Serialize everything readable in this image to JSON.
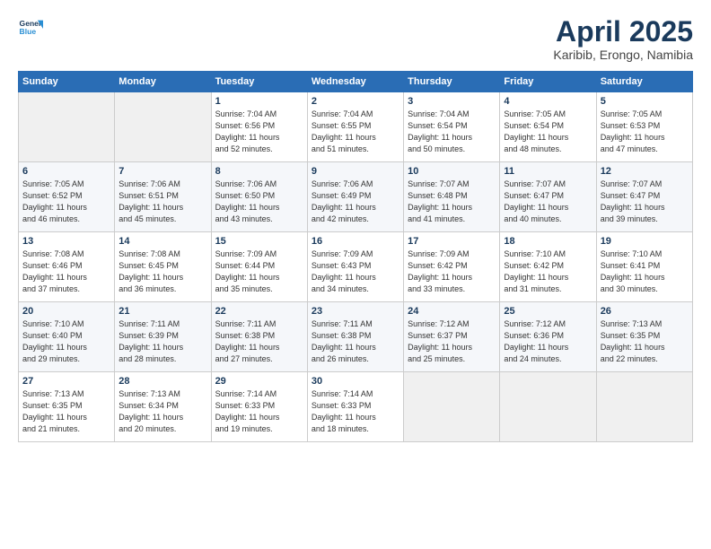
{
  "logo": {
    "line1": "General",
    "line2": "Blue"
  },
  "title": "April 2025",
  "location": "Karibib, Erongo, Namibia",
  "header_days": [
    "Sunday",
    "Monday",
    "Tuesday",
    "Wednesday",
    "Thursday",
    "Friday",
    "Saturday"
  ],
  "weeks": [
    [
      {
        "day": "",
        "info": ""
      },
      {
        "day": "",
        "info": ""
      },
      {
        "day": "1",
        "info": "Sunrise: 7:04 AM\nSunset: 6:56 PM\nDaylight: 11 hours\nand 52 minutes."
      },
      {
        "day": "2",
        "info": "Sunrise: 7:04 AM\nSunset: 6:55 PM\nDaylight: 11 hours\nand 51 minutes."
      },
      {
        "day": "3",
        "info": "Sunrise: 7:04 AM\nSunset: 6:54 PM\nDaylight: 11 hours\nand 50 minutes."
      },
      {
        "day": "4",
        "info": "Sunrise: 7:05 AM\nSunset: 6:54 PM\nDaylight: 11 hours\nand 48 minutes."
      },
      {
        "day": "5",
        "info": "Sunrise: 7:05 AM\nSunset: 6:53 PM\nDaylight: 11 hours\nand 47 minutes."
      }
    ],
    [
      {
        "day": "6",
        "info": "Sunrise: 7:05 AM\nSunset: 6:52 PM\nDaylight: 11 hours\nand 46 minutes."
      },
      {
        "day": "7",
        "info": "Sunrise: 7:06 AM\nSunset: 6:51 PM\nDaylight: 11 hours\nand 45 minutes."
      },
      {
        "day": "8",
        "info": "Sunrise: 7:06 AM\nSunset: 6:50 PM\nDaylight: 11 hours\nand 43 minutes."
      },
      {
        "day": "9",
        "info": "Sunrise: 7:06 AM\nSunset: 6:49 PM\nDaylight: 11 hours\nand 42 minutes."
      },
      {
        "day": "10",
        "info": "Sunrise: 7:07 AM\nSunset: 6:48 PM\nDaylight: 11 hours\nand 41 minutes."
      },
      {
        "day": "11",
        "info": "Sunrise: 7:07 AM\nSunset: 6:47 PM\nDaylight: 11 hours\nand 40 minutes."
      },
      {
        "day": "12",
        "info": "Sunrise: 7:07 AM\nSunset: 6:47 PM\nDaylight: 11 hours\nand 39 minutes."
      }
    ],
    [
      {
        "day": "13",
        "info": "Sunrise: 7:08 AM\nSunset: 6:46 PM\nDaylight: 11 hours\nand 37 minutes."
      },
      {
        "day": "14",
        "info": "Sunrise: 7:08 AM\nSunset: 6:45 PM\nDaylight: 11 hours\nand 36 minutes."
      },
      {
        "day": "15",
        "info": "Sunrise: 7:09 AM\nSunset: 6:44 PM\nDaylight: 11 hours\nand 35 minutes."
      },
      {
        "day": "16",
        "info": "Sunrise: 7:09 AM\nSunset: 6:43 PM\nDaylight: 11 hours\nand 34 minutes."
      },
      {
        "day": "17",
        "info": "Sunrise: 7:09 AM\nSunset: 6:42 PM\nDaylight: 11 hours\nand 33 minutes."
      },
      {
        "day": "18",
        "info": "Sunrise: 7:10 AM\nSunset: 6:42 PM\nDaylight: 11 hours\nand 31 minutes."
      },
      {
        "day": "19",
        "info": "Sunrise: 7:10 AM\nSunset: 6:41 PM\nDaylight: 11 hours\nand 30 minutes."
      }
    ],
    [
      {
        "day": "20",
        "info": "Sunrise: 7:10 AM\nSunset: 6:40 PM\nDaylight: 11 hours\nand 29 minutes."
      },
      {
        "day": "21",
        "info": "Sunrise: 7:11 AM\nSunset: 6:39 PM\nDaylight: 11 hours\nand 28 minutes."
      },
      {
        "day": "22",
        "info": "Sunrise: 7:11 AM\nSunset: 6:38 PM\nDaylight: 11 hours\nand 27 minutes."
      },
      {
        "day": "23",
        "info": "Sunrise: 7:11 AM\nSunset: 6:38 PM\nDaylight: 11 hours\nand 26 minutes."
      },
      {
        "day": "24",
        "info": "Sunrise: 7:12 AM\nSunset: 6:37 PM\nDaylight: 11 hours\nand 25 minutes."
      },
      {
        "day": "25",
        "info": "Sunrise: 7:12 AM\nSunset: 6:36 PM\nDaylight: 11 hours\nand 24 minutes."
      },
      {
        "day": "26",
        "info": "Sunrise: 7:13 AM\nSunset: 6:35 PM\nDaylight: 11 hours\nand 22 minutes."
      }
    ],
    [
      {
        "day": "27",
        "info": "Sunrise: 7:13 AM\nSunset: 6:35 PM\nDaylight: 11 hours\nand 21 minutes."
      },
      {
        "day": "28",
        "info": "Sunrise: 7:13 AM\nSunset: 6:34 PM\nDaylight: 11 hours\nand 20 minutes."
      },
      {
        "day": "29",
        "info": "Sunrise: 7:14 AM\nSunset: 6:33 PM\nDaylight: 11 hours\nand 19 minutes."
      },
      {
        "day": "30",
        "info": "Sunrise: 7:14 AM\nSunset: 6:33 PM\nDaylight: 11 hours\nand 18 minutes."
      },
      {
        "day": "",
        "info": ""
      },
      {
        "day": "",
        "info": ""
      },
      {
        "day": "",
        "info": ""
      }
    ]
  ]
}
